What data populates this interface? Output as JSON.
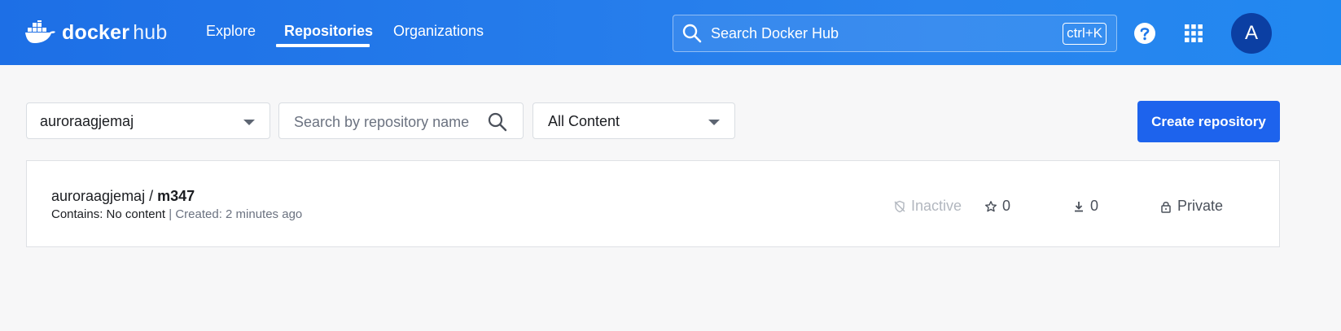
{
  "header": {
    "logo": {
      "docker": "docker",
      "hub": "hub"
    },
    "nav": [
      {
        "label": "Explore"
      },
      {
        "label": "Repositories"
      },
      {
        "label": "Organizations"
      }
    ],
    "search": {
      "placeholder": "Search Docker Hub",
      "shortcut": "ctrl+K"
    },
    "avatar_initial": "A"
  },
  "toolbar": {
    "namespace": "auroraagjemaj",
    "repo_search_placeholder": "Search by repository name",
    "content_filter": "All Content",
    "create_label": "Create repository"
  },
  "repositories": [
    {
      "namespace": "auroraagjemaj",
      "separator": " / ",
      "name": "m347",
      "contains": "Contains: No content",
      "created": " | Created: 2 minutes ago",
      "status": "Inactive",
      "stars": "0",
      "pulls": "0",
      "visibility": "Private"
    }
  ],
  "colors": {
    "header_blue": "#1d6fe6",
    "primary_button": "#1d63ed",
    "avatar_bg": "#0b3fa3"
  }
}
